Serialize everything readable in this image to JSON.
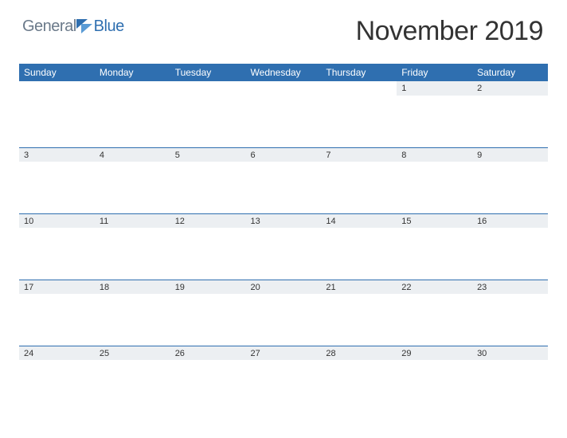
{
  "brand": {
    "part1": "General",
    "part2": "Blue"
  },
  "title": "November 2019",
  "days": [
    "Sunday",
    "Monday",
    "Tuesday",
    "Wednesday",
    "Thursday",
    "Friday",
    "Saturday"
  ],
  "weeks": [
    [
      "",
      "",
      "",
      "",
      "",
      "1",
      "2"
    ],
    [
      "3",
      "4",
      "5",
      "6",
      "7",
      "8",
      "9"
    ],
    [
      "10",
      "11",
      "12",
      "13",
      "14",
      "15",
      "16"
    ],
    [
      "17",
      "18",
      "19",
      "20",
      "21",
      "22",
      "23"
    ],
    [
      "24",
      "25",
      "26",
      "27",
      "28",
      "29",
      "30"
    ]
  ]
}
